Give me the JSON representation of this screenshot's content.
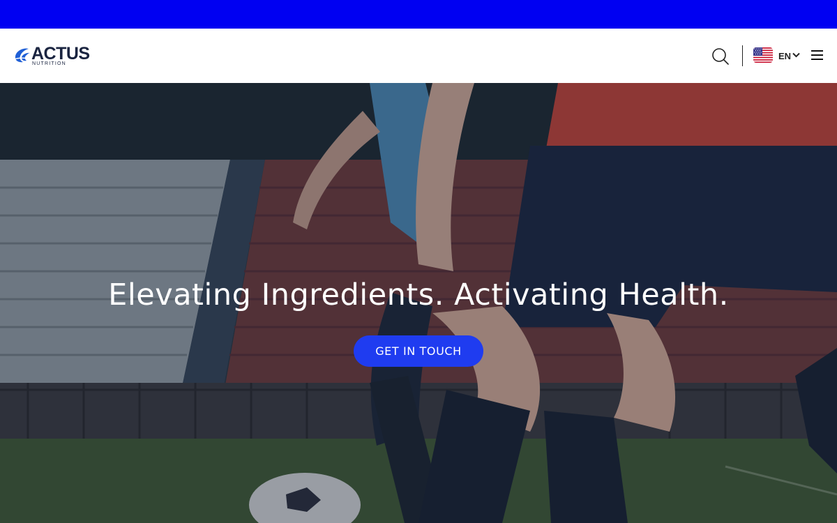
{
  "colors": {
    "announcement_bar": "#0000f2",
    "header_bg": "#ffffff",
    "brand_dark": "#1a2440",
    "brand_blue": "#1f5fd6",
    "cta_bg": "#1f3cf0"
  },
  "header": {
    "logo": {
      "word": "ACTUS",
      "tagline": "NUTRITION",
      "icon": "actus-swoosh-icon"
    },
    "search": {
      "icon": "search-icon"
    },
    "language": {
      "flag_icon": "us-flag-icon",
      "code": "EN",
      "chevron_icon": "chevron-down-icon"
    },
    "menu": {
      "icon": "hamburger-menu-icon"
    }
  },
  "hero": {
    "background": "soccer-players-stadium-image",
    "headline": "Elevating Ingredients. Activating Health.",
    "cta_label": "GET IN TOUCH"
  }
}
